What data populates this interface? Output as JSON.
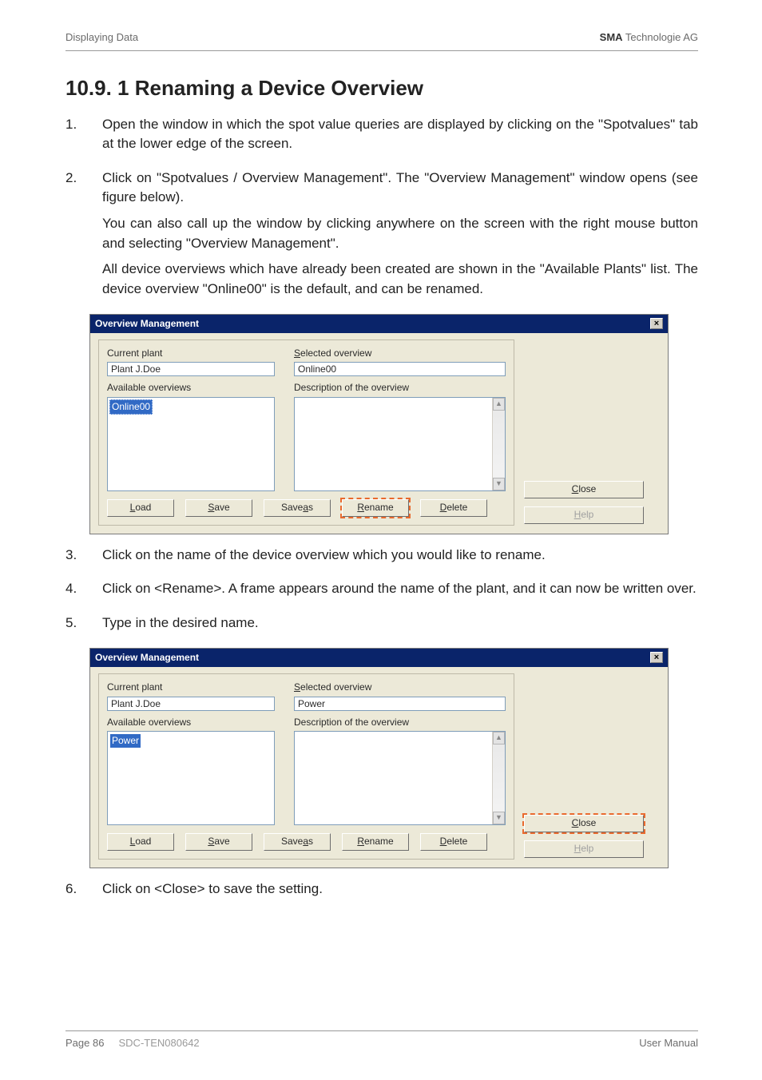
{
  "header": {
    "left": "Displaying Data",
    "right_bold": "SMA",
    "right_rest": " Technologie AG"
  },
  "title": "10.9. 1 Renaming a Device Overview",
  "steps": {
    "s1": {
      "num": "1.",
      "text": "Open the window in which the spot value queries are displayed by clicking on the \"Spotvalues\" tab at the lower edge of the screen."
    },
    "s2": {
      "num": "2.",
      "p1": "Click on \"Spotvalues / Overview Management\". The \"Overview Management\" window opens (see figure below).",
      "p2": "You can also call up the window by clicking anywhere on the screen with the right mouse button and selecting \"Overview Management\".",
      "p3": "All device overviews which have already been created are shown in the \"Available Plants\" list. The device overview \"Online00\" is the default, and can be renamed."
    },
    "s3": {
      "num": "3.",
      "text": "Click on the name of the device overview which you would like to rename."
    },
    "s4": {
      "num": "4.",
      "text": "Click on <Rename>. A frame appears around the name of the plant, and it can now be written over."
    },
    "s5": {
      "num": "5.",
      "text": "Type in the desired name."
    },
    "s6": {
      "num": "6.",
      "text": "Click on <Close> to save the setting."
    }
  },
  "dialog": {
    "title": "Overview Management",
    "labels": {
      "current_plant_pre": "Current plant",
      "available_pre": "Available overviews",
      "selected_ul": "S",
      "selected_rest": "elected overview",
      "desc_pre": "Description of the overview"
    },
    "fields": {
      "current_plant": "Plant J.Doe",
      "selected_a": "Online00",
      "selected_b": "Power",
      "list_a": "Online00",
      "list_b": "Power"
    },
    "buttons": {
      "close_ul": "C",
      "close_rest": "lose",
      "help_ul": "H",
      "help_rest": "elp",
      "load_ul": "L",
      "load_rest": "oad",
      "save_ul": "S",
      "save_rest": "ave",
      "saveas_pre": "Save ",
      "saveas_ul": "a",
      "saveas_rest": "s",
      "rename_ul": "R",
      "rename_rest": "ename",
      "delete_ul": "D",
      "delete_rest": "elete"
    }
  },
  "footer": {
    "page": "Page 86",
    "doc": "SDC-TEN080642",
    "right": "User Manual"
  }
}
